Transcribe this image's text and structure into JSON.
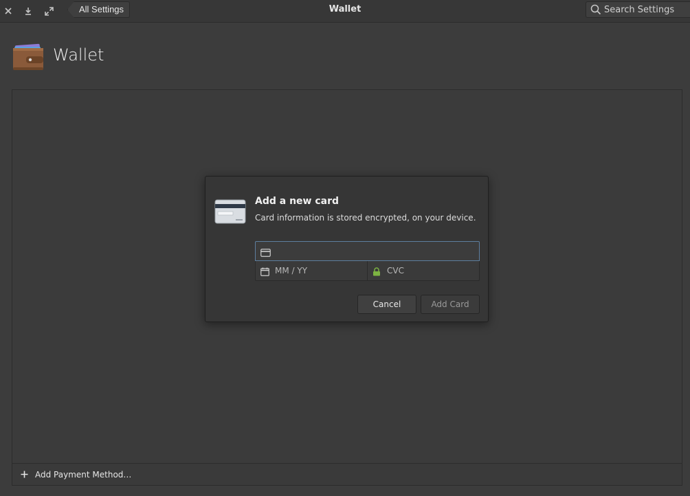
{
  "window": {
    "title": "Wallet"
  },
  "headerbar": {
    "back_label": "All Settings",
    "search_placeholder": "Search Settings"
  },
  "page": {
    "title": "Wallet",
    "icon": "wallet-icon"
  },
  "toolbar": {
    "add_payment_label": "Add Payment Method…",
    "add_icon": "plus-icon"
  },
  "dialog": {
    "title": "Add a new card",
    "subtitle": "Card information is stored encrypted, on your device.",
    "icon": "credit-card-icon",
    "card_number": {
      "value": "",
      "placeholder": ""
    },
    "expiry": {
      "value": "",
      "placeholder": "MM / YY"
    },
    "cvc": {
      "value": "",
      "placeholder": "CVC"
    },
    "cancel_label": "Cancel",
    "add_card_label": "Add Card"
  },
  "colors": {
    "background": "#3c3c3c",
    "focus_border": "#5e7fa0",
    "lock_icon": "#7cb342"
  }
}
